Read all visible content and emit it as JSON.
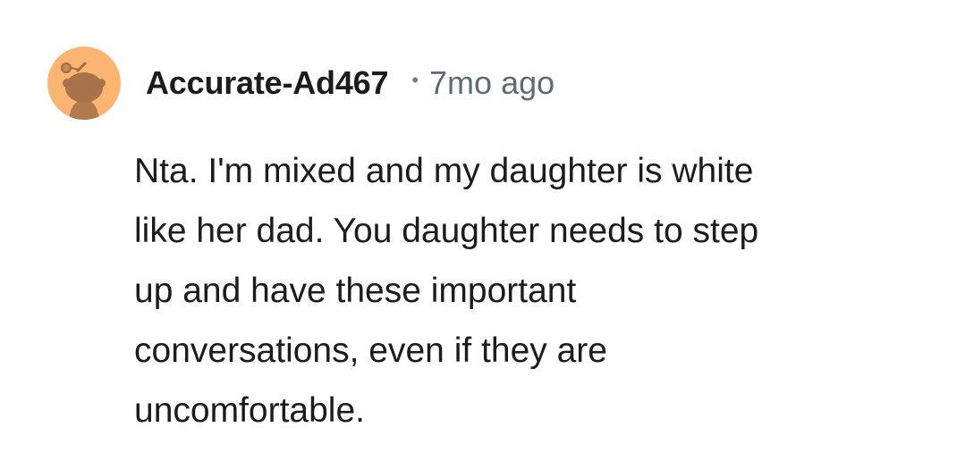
{
  "comment": {
    "author": "Accurate-Ad467",
    "separator": "•",
    "timestamp": "7mo ago",
    "avatar_icon": "snoo-avatar-icon",
    "avatar_bg": "#fcb473",
    "body_lines": [
      "Nta. I'm mixed and my daughter is white",
      "like her dad. You daughter needs to step",
      "up and have these important",
      "conversations, even if they are",
      "uncomfortable."
    ]
  }
}
